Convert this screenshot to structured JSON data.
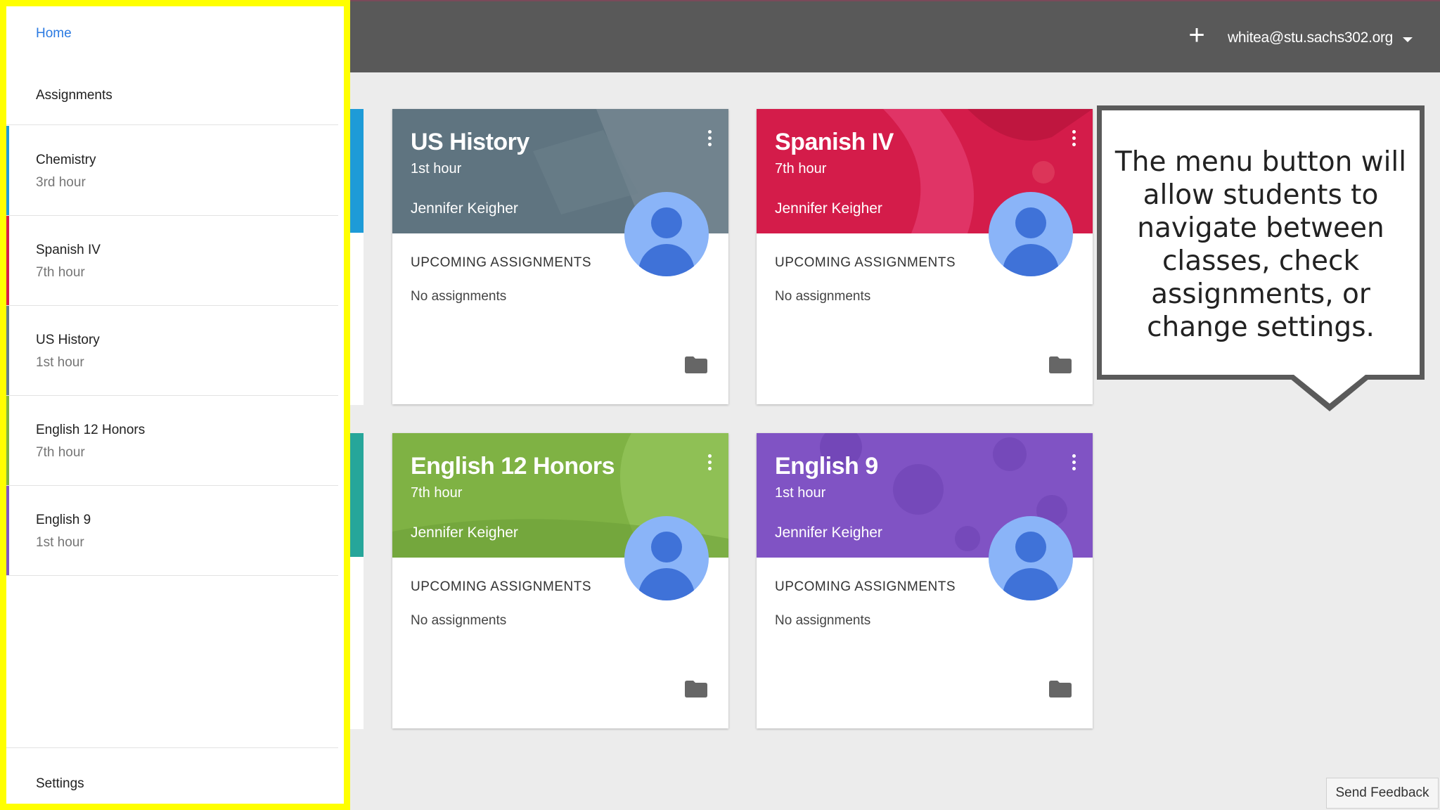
{
  "topbar": {
    "add_label": "+",
    "account": "whitea@stu.sachs302.org"
  },
  "sidebar": {
    "home": "Home",
    "assignments": "Assignments",
    "classes": [
      {
        "name": "Chemistry",
        "hour": "3rd hour",
        "color": "#1e9bd7"
      },
      {
        "name": "Spanish IV",
        "hour": "7th hour",
        "color": "#d81b4a"
      },
      {
        "name": "US History",
        "hour": "1st hour",
        "color": "#607d8b"
      },
      {
        "name": "English 12 Honors",
        "hour": "7th hour",
        "color": "#7cb342"
      },
      {
        "name": "English 9",
        "hour": "1st hour",
        "color": "#7e57c2"
      }
    ],
    "settings": "Settings"
  },
  "cards": [
    {
      "title": "US History",
      "hour": "1st hour",
      "teacher": "Jennifer Keigher",
      "upcoming": "UPCOMING ASSIGNMENTS",
      "status": "No assignments",
      "color": "#607d8b"
    },
    {
      "title": "Spanish IV",
      "hour": "7th hour",
      "teacher": "Jennifer Keigher",
      "upcoming": "UPCOMING ASSIGNMENTS",
      "status": "No assignments",
      "color": "#d81b4a"
    },
    {
      "title": "English 12 Honors",
      "hour": "7th hour",
      "teacher": "Jennifer Keigher",
      "upcoming": "UPCOMING ASSIGNMENTS",
      "status": "No assignments",
      "color": "#7cb342"
    },
    {
      "title": "English 9",
      "hour": "1st hour",
      "teacher": "Jennifer Keigher",
      "upcoming": "UPCOMING ASSIGNMENTS",
      "status": "No assignments",
      "color": "#7e57c2"
    }
  ],
  "callout": {
    "text": "The menu button will allow students to navigate between classes, check assignments, or change settings."
  },
  "feedback": "Send Feedback",
  "colors": {
    "highlight": "#ffff00",
    "topbar": "#595959",
    "link": "#2a7ae2"
  }
}
